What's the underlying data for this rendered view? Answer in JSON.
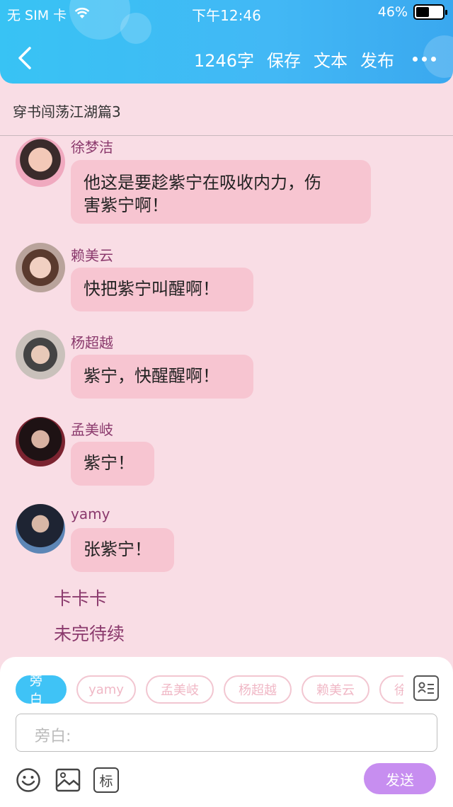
{
  "status_bar": {
    "carrier": "无 SIM 卡",
    "time": "下午12:46",
    "battery": "46%"
  },
  "toolbar": {
    "word_count": "1246字",
    "save": "保存",
    "text": "文本",
    "publish": "发布"
  },
  "story_title": "穿书闯荡江湖篇3",
  "messages": [
    {
      "speaker": "徐梦洁",
      "text_line1": "他这是要趁紫宁在吸收内力，伤",
      "text_line2": "害紫宁啊！"
    },
    {
      "speaker": "赖美云",
      "text": "快把紫宁叫醒啊！"
    },
    {
      "speaker": "杨超越",
      "text": "紫宁，快醒醒啊！"
    },
    {
      "speaker": "孟美岐",
      "text": "紫宁！"
    },
    {
      "speaker": "yamy",
      "text": "张紫宁！"
    }
  ],
  "narrations": [
    "卡卡卡",
    "未完待续"
  ],
  "composer": {
    "chips": [
      "旁白",
      "yamy",
      "孟美岐",
      "杨超越",
      "赖美云",
      "徐梦洁"
    ],
    "placeholder": "旁白:",
    "send": "发送",
    "tag_icon_text": "标"
  },
  "colors": {
    "header": "#38c3f4",
    "bubble": "#f7c5d1",
    "background": "#f9dde5",
    "send": "#c78ef0",
    "speaker": "#8b3a6d"
  }
}
